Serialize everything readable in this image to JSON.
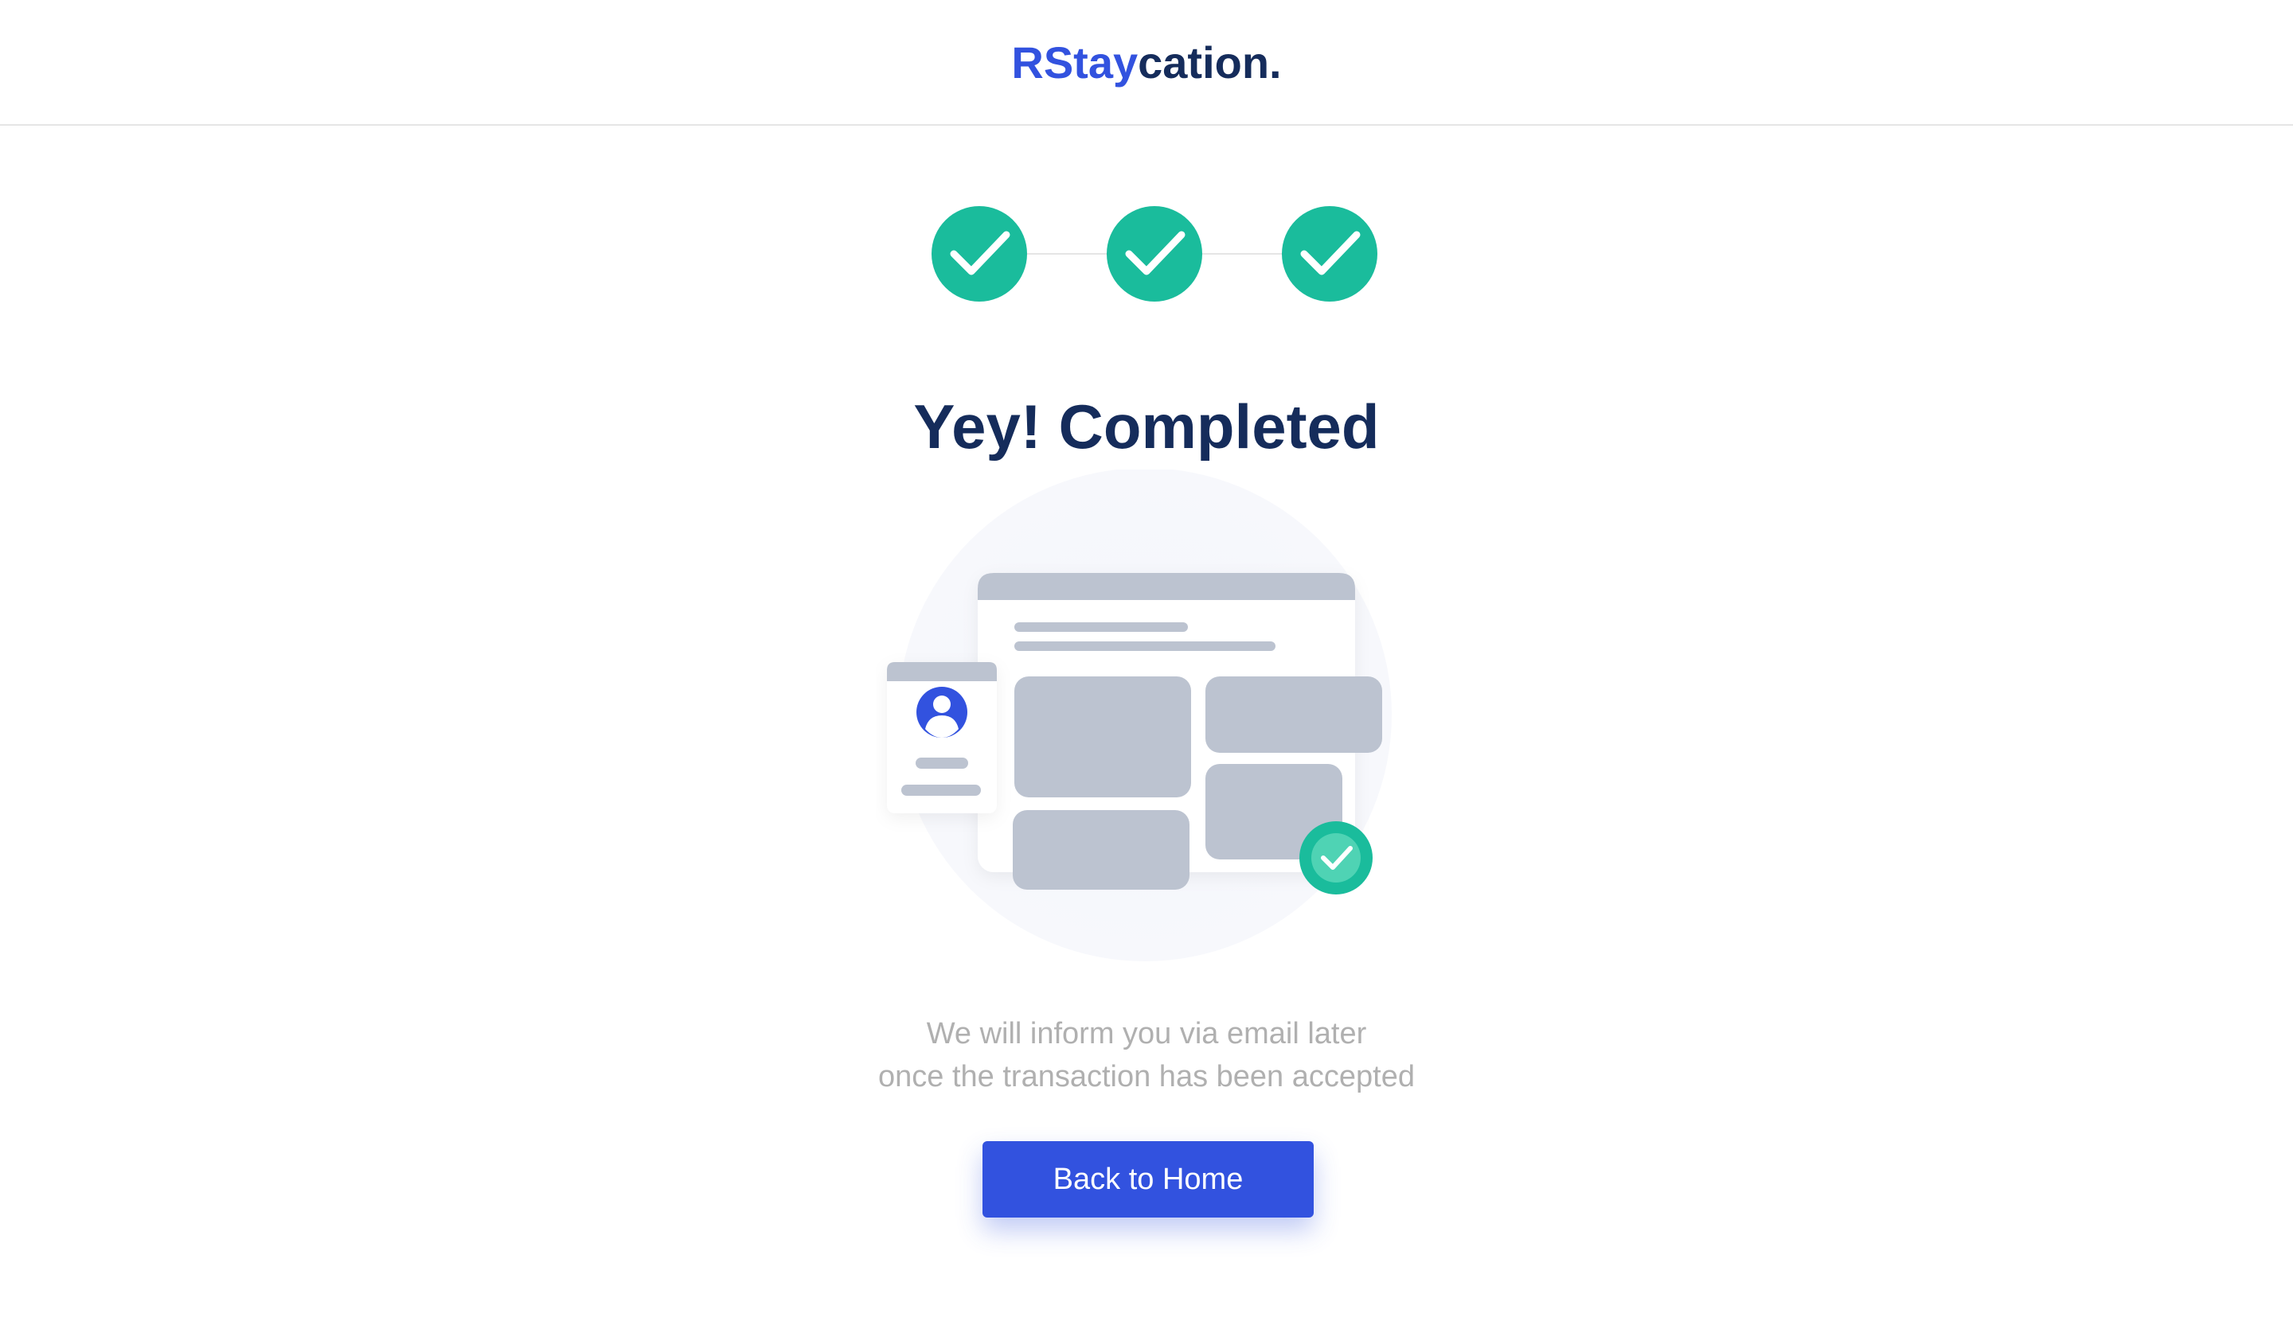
{
  "header": {
    "brand_primary": "RStay",
    "brand_secondary": "cation."
  },
  "stepper": {
    "steps": [
      {
        "status": "completed",
        "icon": "checkmark-icon"
      },
      {
        "status": "completed",
        "icon": "checkmark-icon"
      },
      {
        "status": "completed",
        "icon": "checkmark-icon"
      }
    ]
  },
  "main": {
    "title": "Yey! Completed",
    "message_line1": "We will inform you via email later",
    "message_line2": "once the transaction has been accepted",
    "back_button_label": "Back to Home"
  },
  "colors": {
    "brand_blue": "#3252df",
    "navy": "#152c5b",
    "success_green": "#1abc9c",
    "muted_text": "#b0b0b0",
    "placeholder_gray": "#bcc3d0"
  }
}
